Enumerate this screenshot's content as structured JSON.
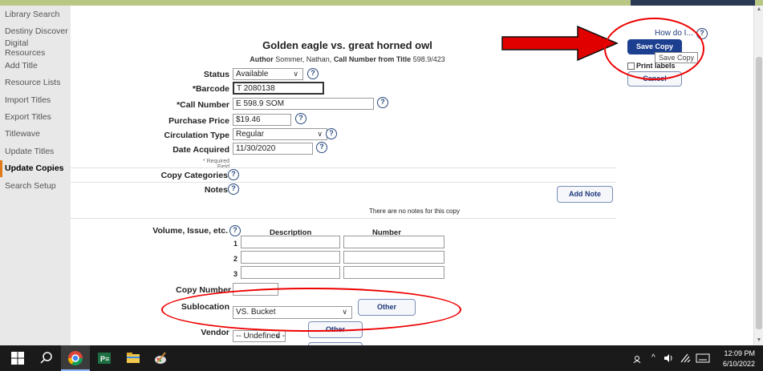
{
  "sidebar": {
    "items": [
      {
        "label": "Library Search"
      },
      {
        "label": "Destiny Discover"
      },
      {
        "label": "Digital Resources"
      },
      {
        "label": "Add Title"
      },
      {
        "label": "Resource Lists"
      },
      {
        "label": "Import Titles"
      },
      {
        "label": "Export Titles"
      },
      {
        "label": "Titlewave"
      },
      {
        "label": "Update Titles"
      },
      {
        "label": "Update Copies"
      },
      {
        "label": "Search Setup"
      }
    ]
  },
  "header": {
    "title": "Golden eagle vs. great horned owl",
    "author_label": "Author",
    "author_value": "Sommer, Nathan,",
    "call_label": "Call Number from Title",
    "call_value": "598.9/423",
    "how_do_i": "How do I..."
  },
  "form": {
    "status_label": "Status",
    "status_value": "Available",
    "barcode_label": "*Barcode",
    "barcode_value": "T 2080138",
    "call_number_label": "*Call Number",
    "call_number_value": "E 598.9 SOM",
    "price_label": "Purchase Price",
    "price_value": "$19.46",
    "circ_label": "Circulation Type",
    "circ_value": "Regular",
    "date_label": "Date Acquired",
    "date_value": "11/30/2020",
    "required_note": "* Required Field",
    "categories_label": "Copy Categories",
    "notes_label": "Notes",
    "add_note_label": "Add Note",
    "no_notes_text": "There are no notes for this copy",
    "volume_label": "Volume, Issue, etc.",
    "desc_header": "Description",
    "number_header": "Number",
    "row_numbers": [
      "1",
      "2",
      "3"
    ],
    "copy_number_label": "Copy Number",
    "sublocation_label": "Sublocation",
    "sublocation_value": "VS. Bucket",
    "other_label": "Other",
    "vendor_label": "Vendor",
    "vendor_value": "-- Undefined --",
    "vendor_other_label": "Other"
  },
  "actions": {
    "save_copy_label": "Save Copy",
    "save_copy_tooltip": "Save Copy",
    "print_labels_label": "Print labels",
    "cancel_label": "Cancel"
  },
  "taskbar": {
    "time": "12:09 PM",
    "date": "6/10/2022"
  },
  "colors": {
    "accent": "#1c3f8f",
    "annotation": "#e00000",
    "sidebar_active": "#e07a1a"
  }
}
